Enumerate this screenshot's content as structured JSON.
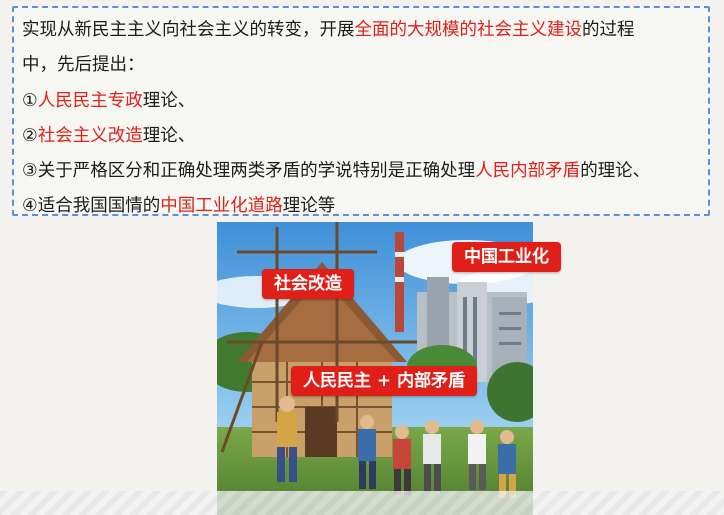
{
  "text": {
    "line1_a": "实现从新民主主义向社会主义的转变，开展",
    "line1_red": "全面的大规模的社会主义建设",
    "line1_b": "的过程",
    "line2": "中，先后提出：",
    "line3_num": "①",
    "line3_red": "人民民主专政",
    "line3_b": "理论、",
    "line4_num": "②",
    "line4_red": "社会主义改造",
    "line4_b": "理论、",
    "line5_a": "③关于严格区分和正确处理两类矛盾的学说特别是正确处理",
    "line5_red": "人民内部矛盾",
    "line5_b": "的理论、",
    "line6_a": "④适合我国国情的",
    "line6_red": "中国工业化道路",
    "line6_b": "理论等"
  },
  "picture": {
    "tags": [
      "社会改造",
      "中国工业化",
      "人民民主 + 内部矛盾"
    ]
  },
  "colors": {
    "accent_red": "#e0201a",
    "border_blue": "#5b8fd6"
  }
}
